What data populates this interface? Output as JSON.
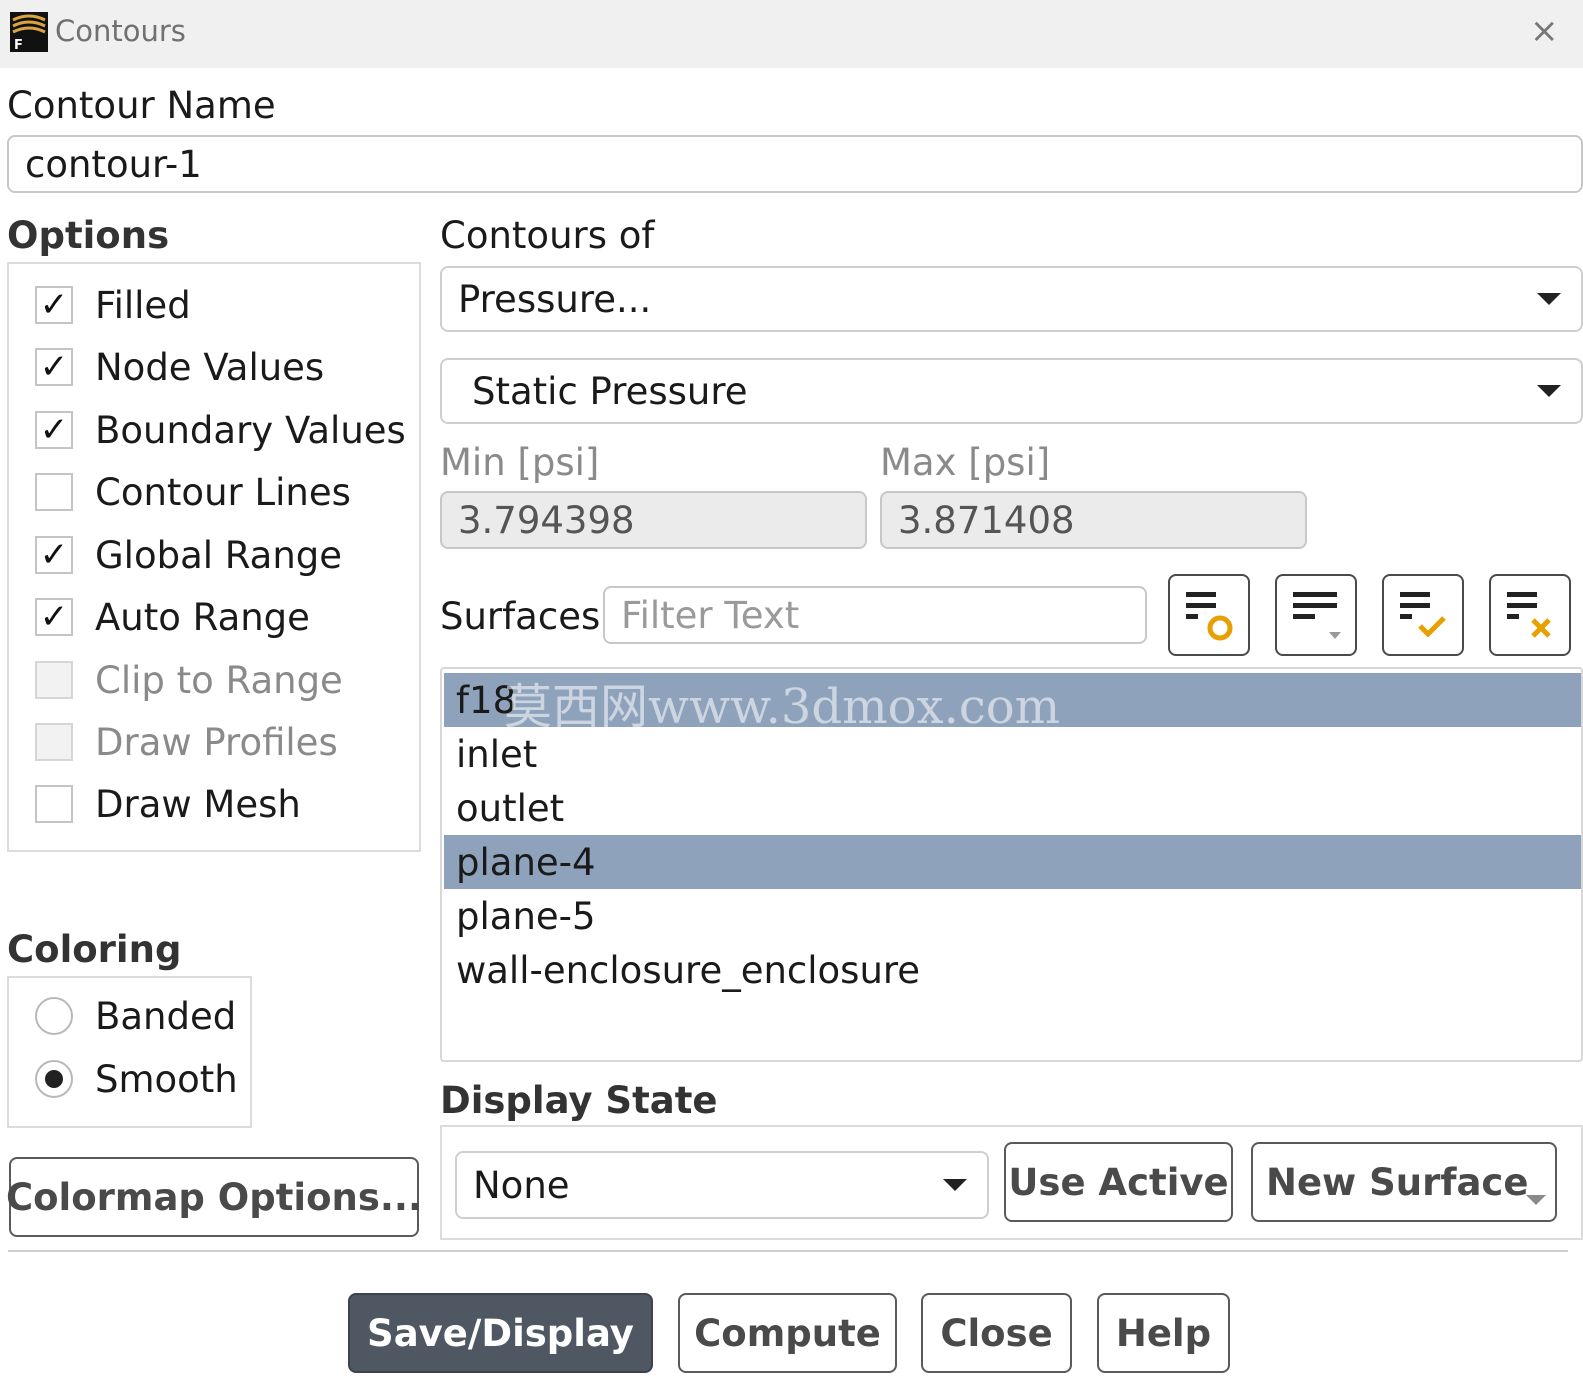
{
  "window": {
    "title": "Contours",
    "close_glyph": "×",
    "app_icon": "fluent-logo-icon"
  },
  "contour_name": {
    "label": "Contour Name",
    "value": "contour-1"
  },
  "options": {
    "heading": "Options",
    "items": [
      {
        "label": "Filled",
        "checked": true,
        "enabled": true
      },
      {
        "label": "Node Values",
        "checked": true,
        "enabled": true
      },
      {
        "label": "Boundary Values",
        "checked": true,
        "enabled": true
      },
      {
        "label": "Contour Lines",
        "checked": false,
        "enabled": true
      },
      {
        "label": "Global Range",
        "checked": true,
        "enabled": true
      },
      {
        "label": "Auto Range",
        "checked": true,
        "enabled": true
      },
      {
        "label": "Clip to Range",
        "checked": false,
        "enabled": false
      },
      {
        "label": "Draw Profiles",
        "checked": false,
        "enabled": false
      },
      {
        "label": "Draw Mesh",
        "checked": false,
        "enabled": true
      }
    ]
  },
  "check_glyph": "✓",
  "contours_of": {
    "label": "Contours of",
    "category": "Pressure...",
    "variable": "Static Pressure"
  },
  "range": {
    "min_label": "Min [psi]",
    "min_value": "3.794398",
    "max_label": "Max [psi]",
    "max_value": "3.871408"
  },
  "surfaces": {
    "label": "Surfaces",
    "filter_placeholder": "Filter Text",
    "toolbar_icons": [
      "select-new-surfaces-icon",
      "sort-list-icon",
      "select-all-icon",
      "deselect-all-icon"
    ],
    "items": [
      {
        "label": "f18",
        "selected": true
      },
      {
        "label": "inlet",
        "selected": false
      },
      {
        "label": "outlet",
        "selected": false
      },
      {
        "label": "plane-4",
        "selected": true
      },
      {
        "label": "plane-5",
        "selected": false
      },
      {
        "label": "wall-enclosure_enclosure",
        "selected": false
      }
    ],
    "watermark": "莫西网www.3dmox.com"
  },
  "coloring": {
    "heading": "Coloring",
    "banded": "Banded",
    "smooth": "Smooth",
    "selected": "Smooth"
  },
  "display_state": {
    "heading": "Display State",
    "value": "None",
    "use_active": "Use Active",
    "new_surface": "New Surface"
  },
  "colormap_button": "Colormap Options...",
  "footer": {
    "save_display": "Save/Display",
    "compute": "Compute",
    "close": "Close",
    "help": "Help"
  },
  "colors": {
    "selection": "#8ea3bb",
    "primary_button": "#4f5763",
    "icon_accent": "#e8a000"
  }
}
